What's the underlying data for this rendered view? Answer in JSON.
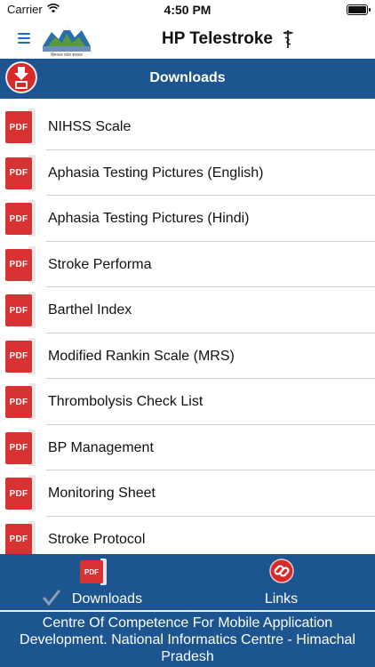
{
  "status_bar": {
    "carrier": "Carrier",
    "time": "4:50 PM"
  },
  "nav": {
    "title": "HP Telestroke",
    "emblem_text": "हिमाचल प्रदेश सरकार"
  },
  "section": {
    "title": "Downloads"
  },
  "downloads": {
    "pdf_badge": "PDF",
    "items": [
      {
        "label": "NIHSS Scale"
      },
      {
        "label": "Aphasia Testing Pictures (English)"
      },
      {
        "label": "Aphasia Testing Pictures (Hindi)"
      },
      {
        "label": "Stroke Performa"
      },
      {
        "label": "Barthel Index"
      },
      {
        "label": "Modified Rankin Scale (MRS)"
      },
      {
        "label": "Thrombolysis Check List"
      },
      {
        "label": "BP Management"
      },
      {
        "label": "Monitoring Sheet"
      },
      {
        "label": "Stroke Protocol"
      }
    ]
  },
  "tabs": {
    "pdf_badge": "PDF",
    "items": [
      {
        "label": "Downloads",
        "icon": "pdf-icon",
        "selected": true
      },
      {
        "label": "Links",
        "icon": "link-icon",
        "selected": false
      }
    ]
  },
  "footer": {
    "text": "Centre Of Competence For Mobile Application Development. National Informatics Centre - Himachal Pradesh"
  },
  "colors": {
    "primary": "#1c5590",
    "pdf_red": "#d93232",
    "menu_blue": "#1e6bc4"
  }
}
